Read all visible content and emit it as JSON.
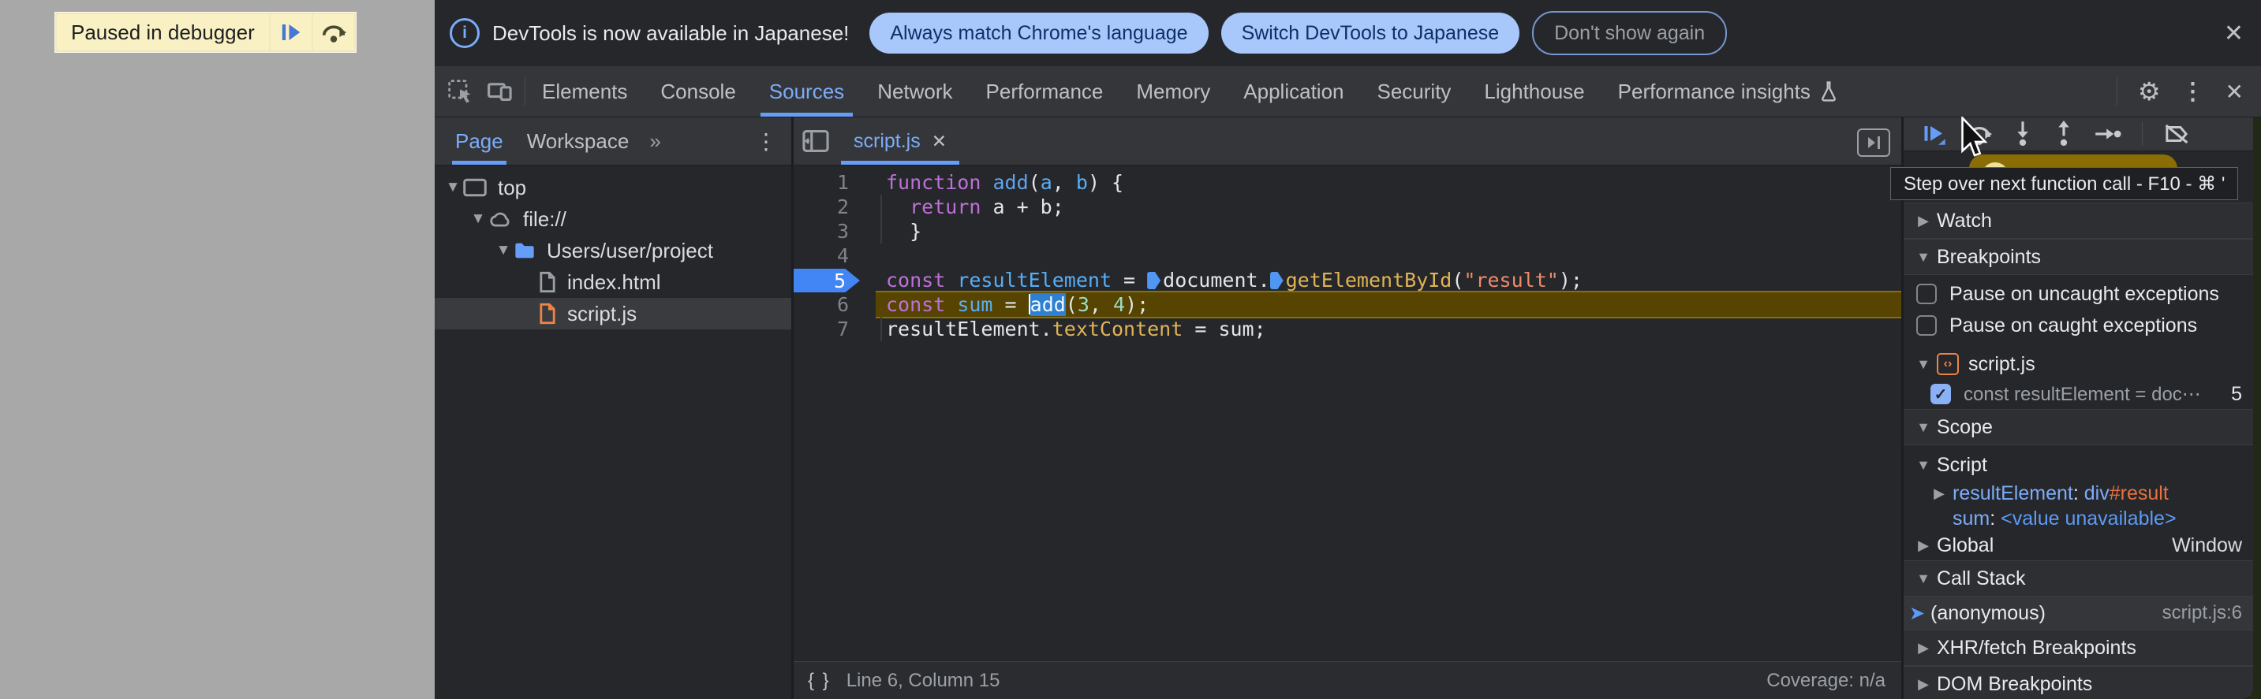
{
  "page": {
    "paused_banner": {
      "label": "Paused in debugger"
    }
  },
  "notification": {
    "message": "DevTools is now available in Japanese!",
    "action_match": "Always match Chrome's language",
    "action_switch": "Switch DevTools to Japanese",
    "action_dismiss": "Don't show again"
  },
  "icons": {
    "gear": "⚙",
    "more": "⋮",
    "close": "✕",
    "overflow": "»",
    "info": "i",
    "pretty_print": "{ }",
    "tab_close": "✕"
  },
  "tabs": {
    "items": [
      "Elements",
      "Console",
      "Sources",
      "Network",
      "Performance",
      "Memory",
      "Application",
      "Security",
      "Lighthouse",
      "Performance insights"
    ],
    "active": "Sources"
  },
  "sidebar": {
    "tab_page": "Page",
    "tab_workspace": "Workspace",
    "tree": [
      {
        "label": "top",
        "icon": "frame-icon",
        "depth": 0,
        "expanded": true
      },
      {
        "label": "file://",
        "icon": "cloud-icon",
        "depth": 1,
        "expanded": true
      },
      {
        "label": "Users/user/project",
        "icon": "folder-icon",
        "depth": 2,
        "expanded": true
      },
      {
        "label": "index.html",
        "icon": "file-html-icon",
        "depth": 3,
        "expanded": null
      },
      {
        "label": "script.js",
        "icon": "file-js-icon",
        "depth": 3,
        "expanded": null,
        "selected": true
      }
    ]
  },
  "editor": {
    "tab": "script.js",
    "lines": [
      {
        "num": "1",
        "tokens": [
          [
            "kw",
            "function"
          ],
          [
            "pl",
            " "
          ],
          [
            "fn",
            "add"
          ],
          [
            "pl",
            "("
          ],
          [
            "var",
            "a"
          ],
          [
            "pl",
            ", "
          ],
          [
            "var",
            "b"
          ],
          [
            "pl",
            ") {"
          ]
        ]
      },
      {
        "num": "2",
        "guide": true,
        "tokens": [
          [
            "pl",
            "  "
          ],
          [
            "kw",
            "return"
          ],
          [
            "pl",
            " a + b;"
          ]
        ]
      },
      {
        "num": "3",
        "guide": true,
        "tokens": [
          [
            "pl",
            "  }"
          ]
        ]
      },
      {
        "num": "4",
        "tokens": []
      },
      {
        "num": "5",
        "breakpoint": true,
        "tokens": [
          [
            "kw",
            "const"
          ],
          [
            "pl",
            " "
          ],
          [
            "var",
            "resultElement"
          ],
          [
            "pl",
            " = "
          ],
          [
            "mark",
            ""
          ],
          [
            "pl",
            "document."
          ],
          [
            "mark",
            ""
          ],
          [
            "prop",
            "getElementById"
          ],
          [
            "pl",
            "("
          ],
          [
            "str",
            "\"result\""
          ],
          [
            "pl",
            ");"
          ]
        ]
      },
      {
        "num": "6",
        "exec": true,
        "tokens": [
          [
            "kw",
            "const"
          ],
          [
            "pl",
            " "
          ],
          [
            "var",
            "sum"
          ],
          [
            "pl",
            " = "
          ],
          [
            "caret",
            ""
          ],
          [
            "sel",
            "add"
          ],
          [
            "pl",
            "("
          ],
          [
            "num",
            "3"
          ],
          [
            "pl",
            ", "
          ],
          [
            "num",
            "4"
          ],
          [
            "pl",
            ");"
          ]
        ]
      },
      {
        "num": "7",
        "guide": true,
        "tokens": [
          [
            "pl",
            "resultElement."
          ],
          [
            "prop",
            "textContent"
          ],
          [
            "pl",
            " = sum;"
          ]
        ]
      }
    ],
    "status": {
      "line_col": "Line 6, Column 15",
      "coverage": "Coverage: n/a"
    }
  },
  "debugger": {
    "tooltip": "Step over next function call - F10 - ⌘ '",
    "watch_label": "Watch",
    "breakpoints_label": "Breakpoints",
    "pause_uncaught": "Pause on uncaught exceptions",
    "pause_caught": "Pause on caught exceptions",
    "breakpoint_file": "script.js",
    "breakpoint_entry": {
      "code": "const resultElement = doc⋯",
      "line": "5"
    },
    "scope_label": "Scope",
    "scope": {
      "section": "Script",
      "var1": {
        "name": "resultElement",
        "value_tag": "div",
        "value_id": "#result"
      },
      "var2": {
        "name": "sum",
        "value": "<value unavailable>"
      },
      "global_label": "Global",
      "global_value": "Window"
    },
    "call_stack_label": "Call Stack",
    "frame": {
      "label": "(anonymous)",
      "location": "script.js:6"
    },
    "xhr_label": "XHR/fetch Breakpoints",
    "dom_label": "DOM Breakpoints"
  }
}
